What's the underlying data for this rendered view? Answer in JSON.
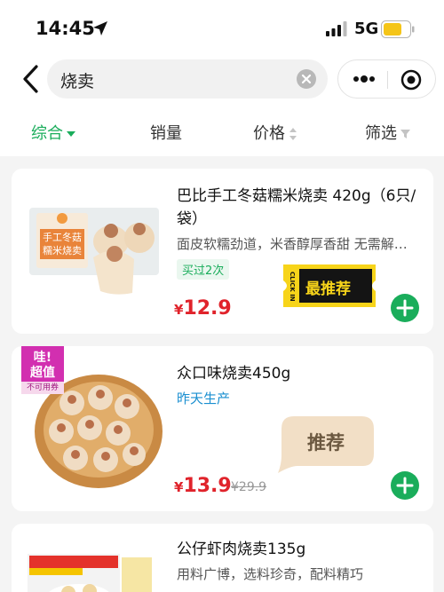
{
  "status_bar": {
    "time": "14:45",
    "network": "5G"
  },
  "search": {
    "query": "烧卖"
  },
  "sort_tabs": [
    {
      "label": "综合",
      "active": true
    },
    {
      "label": "销量"
    },
    {
      "label": "价格"
    },
    {
      "label": "筛选"
    }
  ],
  "products": [
    {
      "title": "巴比手工冬菇糯米烧卖 420g（6只/袋）",
      "description": "面皮软糯劲道，米香醇厚香甜 无需解…",
      "tag": "买过2次",
      "currency": "¥",
      "price": "12.9",
      "badge": {
        "brand_text": "CLICK IN",
        "label": "最推荐"
      },
      "package_text": [
        "手工冬菇",
        "糯米烧卖"
      ]
    },
    {
      "title": "众口味烧卖450g",
      "subtitle": "昨天生产",
      "currency": "¥",
      "price": "13.9",
      "original_price": "¥29.9",
      "promo_badge": {
        "line1": "哇!",
        "line2": "超值",
        "line3": "不可用券"
      },
      "badge": {
        "label": "推荐"
      }
    },
    {
      "title": "公仔虾肉烧卖135g",
      "description": "用料广博，选料珍奇，配料精巧"
    }
  ],
  "colors": {
    "accent_green": "#1aad5b",
    "price_red": "#e0232b",
    "badge_yellow": "#f7d41a"
  }
}
